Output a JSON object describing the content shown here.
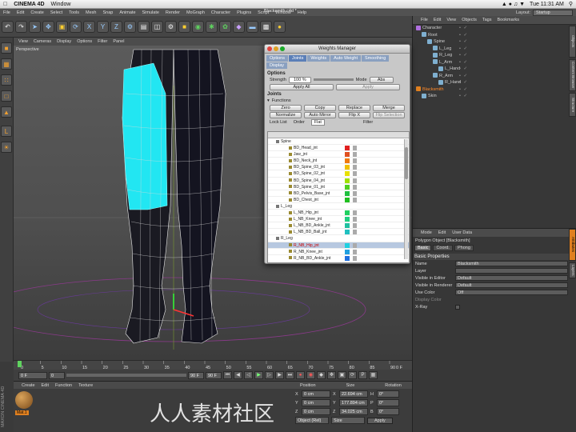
{
  "macbar": {
    "app": "CINEMA 4D",
    "menu": "Window",
    "clock": "Tue 11:31 AM"
  },
  "c4d": {
    "doc_title": "Blacksmith.c4d *",
    "menu": [
      "File",
      "Edit",
      "Create",
      "Select",
      "Tools",
      "Mesh",
      "Snap",
      "Animate",
      "Simulate",
      "Render",
      "MoGraph",
      "Character",
      "Plugins",
      "Script",
      "Window",
      "Help"
    ],
    "layout_label": "Layout:",
    "layout_value": "Startup"
  },
  "viewport": {
    "menu": [
      "View",
      "Cameras",
      "Display",
      "Options",
      "Filter",
      "Panel"
    ],
    "label": "Perspective"
  },
  "timeline": {
    "ticks": [
      "0",
      "5",
      "10",
      "15",
      "20",
      "25",
      "30",
      "35",
      "40",
      "45",
      "50",
      "55",
      "60",
      "65",
      "70",
      "75",
      "80",
      "85",
      "90"
    ],
    "end_label": "0 F"
  },
  "playbar": {
    "start": "0 F",
    "field2": "0",
    "end": "90 F",
    "field4": "90 F"
  },
  "materials": {
    "menu": [
      "Create",
      "Edit",
      "Function",
      "Texture"
    ],
    "mat_name": "Mat.1"
  },
  "coords": {
    "headers": [
      "Position",
      "Size",
      "Rotation"
    ],
    "rows": [
      {
        "axis": "X",
        "pos": "0 cm",
        "size": "22.694 cm",
        "rot_l": "H",
        "rot": "0°"
      },
      {
        "axis": "Y",
        "pos": "0 cm",
        "size": "177.894 cm",
        "rot_l": "P",
        "rot": "0°"
      },
      {
        "axis": "Z",
        "pos": "0 cm",
        "size": "34.025 cm",
        "rot_l": "B",
        "rot": "0°"
      }
    ],
    "mode1": "Object (Rel)",
    "mode2": "Size",
    "apply": "Apply"
  },
  "objects": {
    "menu": [
      "File",
      "Edit",
      "View",
      "Objects",
      "Tags",
      "Bookmarks"
    ],
    "tree": [
      {
        "name": "Character",
        "indent": 0,
        "color": "#d0d0d0"
      },
      {
        "name": "Root",
        "indent": 1,
        "color": "#d0d0d0"
      },
      {
        "name": "Spine",
        "indent": 2,
        "color": "#d0d0d0"
      },
      {
        "name": "L_Leg",
        "indent": 3,
        "color": "#d0d0d0"
      },
      {
        "name": "R_Leg",
        "indent": 3,
        "color": "#d0d0d0"
      },
      {
        "name": "L_Arm",
        "indent": 3,
        "color": "#d0d0d0"
      },
      {
        "name": "L_Hand",
        "indent": 4,
        "color": "#d0d0d0"
      },
      {
        "name": "R_Arm",
        "indent": 3,
        "color": "#d0d0d0"
      },
      {
        "name": "R_Hand",
        "indent": 4,
        "color": "#d0d0d0"
      },
      {
        "name": "Blacksmith",
        "indent": 0,
        "color": "#ff8a2a"
      },
      {
        "name": "Skin",
        "indent": 1,
        "color": "#d0d0d0"
      }
    ]
  },
  "side_tabs_top": [
    "Objects",
    "Content Browser",
    "Structure"
  ],
  "side_tabs_bottom": [
    "Attributes",
    "Layers"
  ],
  "attributes": {
    "menu": [
      "Mode",
      "Edit",
      "User Data"
    ],
    "title": "Polygon Object [Blacksmith]",
    "tabs": [
      "Basic",
      "Coord.",
      "Phong"
    ],
    "section": "Basic Properties",
    "rows": [
      {
        "label": "Name",
        "value": "Blacksmith"
      },
      {
        "label": "Layer",
        "value": ""
      },
      {
        "label": "Visible in Editor",
        "value": "Default"
      },
      {
        "label": "Visible in Renderer",
        "value": "Default"
      },
      {
        "label": "Use Color",
        "value": "Off"
      },
      {
        "label": "Display Color",
        "value": ""
      },
      {
        "label": "X-Ray",
        "value": ""
      }
    ]
  },
  "weights": {
    "title": "Weights Manager",
    "tabs": [
      "Options",
      "Joints",
      "Weights",
      "Auto Weight",
      "Smoothing",
      "Display"
    ],
    "options_hdr": "Options",
    "strength_label": "Strength",
    "strength_value": "100 %",
    "mode_label": "Mode",
    "mode_value": "Abs",
    "apply_all": "Apply All",
    "apply": "Apply",
    "joints_hdr": "Joints",
    "functions_hdr": "Functions",
    "buttons": [
      "Zero",
      "Copy",
      "Replace",
      "Merge",
      "Normalize",
      "Auto Mirror",
      "Flip X",
      "Flip Selection"
    ],
    "list_tabs": [
      "Lock List",
      "Order",
      "Flat",
      "Filter"
    ],
    "joints": [
      {
        "name": "Spine",
        "color": "",
        "sel": false,
        "group": true
      },
      {
        "name": "BD_Head_jnt",
        "color": "#e02020",
        "sel": false
      },
      {
        "name": "Jaw_jnt",
        "color": "#e05020",
        "sel": false
      },
      {
        "name": "BD_Neck_jnt",
        "color": "#f07a10",
        "sel": false
      },
      {
        "name": "BD_Spine_03_jnt",
        "color": "#f0c000",
        "sel": false
      },
      {
        "name": "BD_Spine_02_jnt",
        "color": "#e8e000",
        "sel": false
      },
      {
        "name": "BD_Spine_04_jnt",
        "color": "#a0e000",
        "sel": false
      },
      {
        "name": "BD_Spine_01_jnt",
        "color": "#50d020",
        "sel": false
      },
      {
        "name": "BD_Pelvis_Base_jnt",
        "color": "#20c040",
        "sel": false
      },
      {
        "name": "BD_Chest_jnt",
        "color": "#20c020",
        "sel": false
      },
      {
        "name": "L_Leg",
        "color": "",
        "sel": false,
        "group": true
      },
      {
        "name": "L_NB_Hip_jnt",
        "color": "#20d060",
        "sel": false
      },
      {
        "name": "L_NB_Knee_jnt",
        "color": "#20d080",
        "sel": false
      },
      {
        "name": "L_NB_BD_Ankle_jnt",
        "color": "#20c0a0",
        "sel": false
      },
      {
        "name": "L_NB_BD_Ball_jnt",
        "color": "#20c0c0",
        "sel": false
      },
      {
        "name": "R_Leg",
        "color": "",
        "sel": false,
        "group": true
      },
      {
        "name": "R_NB_Hip_jnt",
        "color": "#20d0e0",
        "sel": true
      },
      {
        "name": "R_NB_Knee_jnt",
        "color": "#20a0e0",
        "sel": false
      },
      {
        "name": "R_NB_BD_Ankle_jnt",
        "color": "#2070e0",
        "sel": false
      },
      {
        "name": "R_NB_BD_Ball_jnt",
        "color": "#2040e0",
        "sel": false
      }
    ]
  },
  "branding": {
    "left_logo": "MAXON CINEMA 4D",
    "watermark": "人人素材社区"
  }
}
